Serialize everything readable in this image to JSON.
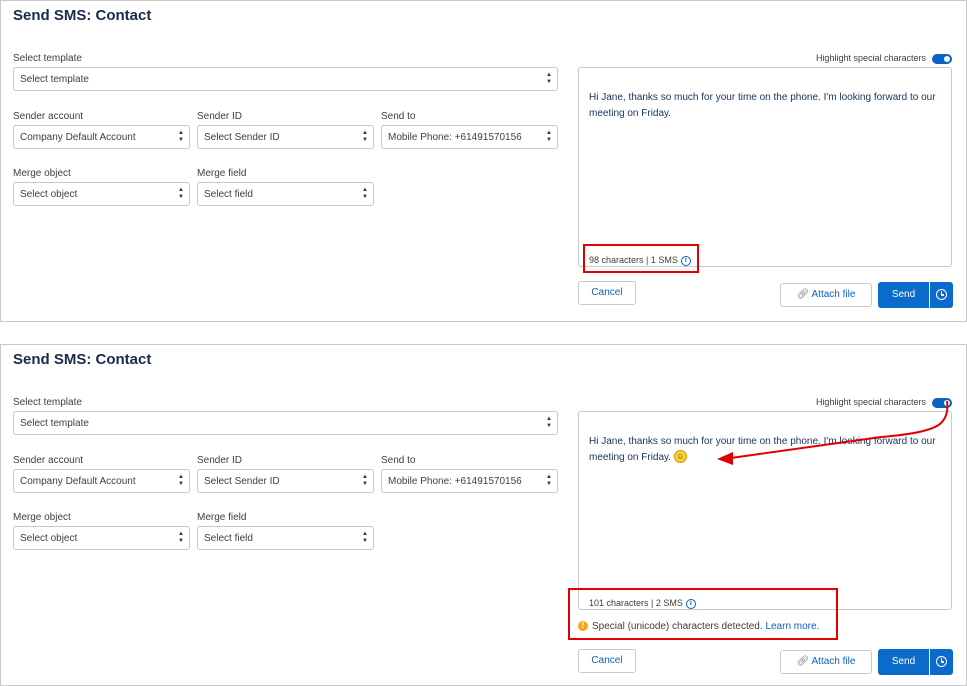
{
  "common": {
    "title": "Send SMS: Contact",
    "select_template_label": "Select template",
    "select_template_value": "Select template",
    "sender_account_label": "Sender account",
    "sender_account_value": "Company Default Account",
    "sender_id_label": "Sender ID",
    "sender_id_value": "Select Sender ID",
    "send_to_label": "Send to",
    "send_to_value": "Mobile Phone: +61491570156",
    "merge_object_label": "Merge object",
    "merge_object_value": "Select object",
    "merge_field_label": "Merge field",
    "merge_field_value": "Select field",
    "highlight_label": "Highlight special characters",
    "cancel_label": "Cancel",
    "attach_label": "Attach file",
    "send_label": "Send"
  },
  "panel1": {
    "message": "Hi Jane, thanks so much for your time on the phone. I'm looking forward to our meeting on Friday.",
    "count": "98 characters | 1 SMS",
    "highlight_on": true
  },
  "panel2": {
    "message": "Hi Jane, thanks so much for your time on the phone. I'm looking forward to our meeting on Friday.",
    "count": "101 characters | 2 SMS",
    "warning_text": "Special (unicode) characters detected.",
    "warning_link": "Learn more.",
    "highlight_on": true
  },
  "colors": {
    "accent": "#0b6bcb",
    "annotation": "#e00000",
    "warning": "#f2a618"
  },
  "icons": {
    "info": "info-icon",
    "paperclip": "paperclip-icon",
    "clock": "clock-icon",
    "emoji": "smiley-emoji-icon",
    "warning": "warning-icon"
  }
}
